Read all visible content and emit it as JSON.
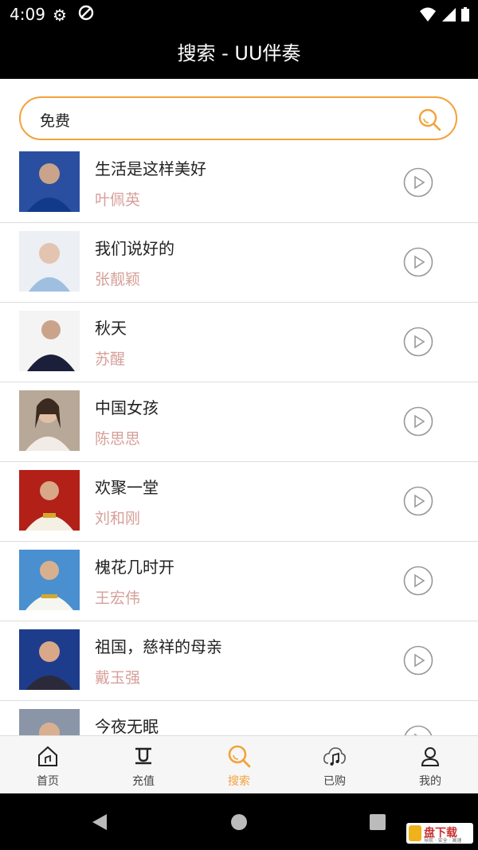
{
  "status_bar": {
    "time": "4:09"
  },
  "header": {
    "title": "搜索 - UU伴奏"
  },
  "search": {
    "value": "免费"
  },
  "songs": [
    {
      "title": "生活是这样美好",
      "singer": "叶佩英"
    },
    {
      "title": "我们说好的",
      "singer": "张靓颖"
    },
    {
      "title": "秋天",
      "singer": "苏醒"
    },
    {
      "title": "中国女孩",
      "singer": "陈思思"
    },
    {
      "title": "欢聚一堂",
      "singer": "刘和刚"
    },
    {
      "title": "槐花几时开",
      "singer": "王宏伟"
    },
    {
      "title": "祖国，慈祥的母亲",
      "singer": "戴玉强"
    },
    {
      "title": "今夜无眠",
      "singer": ""
    }
  ],
  "tabs": [
    {
      "label": "首页",
      "icon": "home-icon"
    },
    {
      "label": "充值",
      "icon": "recharge-icon"
    },
    {
      "label": "搜索",
      "icon": "search-icon",
      "active": true
    },
    {
      "label": "已购",
      "icon": "purchased-icon"
    },
    {
      "label": "我的",
      "icon": "profile-icon"
    }
  ],
  "watermark": {
    "text": "盘下载",
    "sub": "导航 · 安全 · 高速"
  },
  "colors": {
    "accent": "#f3a23a",
    "singer_text": "#d6a09a",
    "bar_bg": "#000000"
  }
}
